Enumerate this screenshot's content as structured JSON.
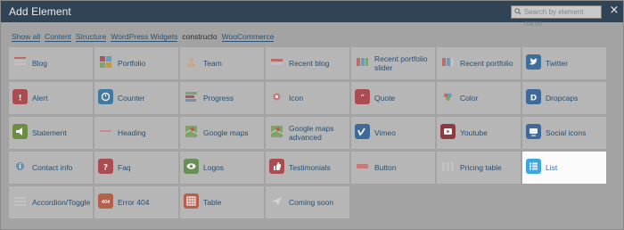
{
  "header": {
    "title": "Add Element",
    "search_placeholder": "Search by element name",
    "close_label": "×"
  },
  "filters": [
    {
      "label": "Show all",
      "kind": "link"
    },
    {
      "label": "Content",
      "kind": "link"
    },
    {
      "label": "Structure",
      "kind": "link"
    },
    {
      "label": "WordPress Widgets",
      "kind": "link"
    },
    {
      "label": "constructo",
      "kind": "plain"
    },
    {
      "label": "WooCommerce",
      "kind": "link"
    }
  ],
  "colors": {
    "header_bg": "#314456",
    "overlay_bg": "#a3a3a3",
    "cell_bg": "#b6b6b6",
    "highlight_bg": "#fbfbfb",
    "link": "#264f73"
  },
  "elements": [
    {
      "label": "Blog",
      "icon": "blog-icon",
      "color": "#9aa3ab"
    },
    {
      "label": "Portfolio",
      "icon": "portfolio-icon",
      "color": "#a3596a"
    },
    {
      "label": "Team",
      "icon": "team-icon",
      "color": "#a88d7a"
    },
    {
      "label": "Recent blog",
      "icon": "recent-blog-icon",
      "color": "#a95860"
    },
    {
      "label": "Recent portfolio slider",
      "icon": "portfolio-slider-icon",
      "color": "#a3596a"
    },
    {
      "label": "Recent portfolio",
      "icon": "recent-portfolio-icon",
      "color": "#a3596a"
    },
    {
      "label": "Twitter",
      "icon": "twitter-icon",
      "color": "#3d6f9a"
    },
    {
      "label": "Alert",
      "icon": "alert-icon",
      "color": "#ab4c52"
    },
    {
      "label": "Counter",
      "icon": "counter-icon",
      "color": "#3f7aa0"
    },
    {
      "label": "Progress",
      "icon": "progress-icon",
      "color": "#6a8f56"
    },
    {
      "label": "Icon",
      "icon": "icon-icon",
      "color": "#ab4c52"
    },
    {
      "label": "Quote",
      "icon": "quote-icon",
      "color": "#ab4c52"
    },
    {
      "label": "Color",
      "icon": "color-icon",
      "color": "#7d8a9a"
    },
    {
      "label": "Dropcaps",
      "icon": "dropcaps-icon",
      "color": "#3d6a9a"
    },
    {
      "label": "Statement",
      "icon": "statement-icon",
      "color": "#6a8f3f"
    },
    {
      "label": "Heading",
      "icon": "heading-icon",
      "color": "#a3a3a3"
    },
    {
      "label": "Google maps",
      "icon": "google-maps-icon",
      "color": "#6a8f56"
    },
    {
      "label": "Google maps advanced",
      "icon": "google-maps-advanced-icon",
      "color": "#6a8f56"
    },
    {
      "label": "Vimeo",
      "icon": "vimeo-icon",
      "color": "#3d6a9a"
    },
    {
      "label": "Youtube",
      "icon": "youtube-icon",
      "color": "#8f3a3f"
    },
    {
      "label": "Social icons",
      "icon": "social-icons-icon",
      "color": "#3d6a9a"
    },
    {
      "label": "Contact info",
      "icon": "contact-info-icon",
      "color": "#c49a3a"
    },
    {
      "label": "Faq",
      "icon": "faq-icon",
      "color": "#ab4c52"
    },
    {
      "label": "Logos",
      "icon": "logos-icon",
      "color": "#6a8f56"
    },
    {
      "label": "Testimonials",
      "icon": "testimonials-icon",
      "color": "#ab4c52"
    },
    {
      "label": "Button",
      "icon": "button-icon",
      "color": "#a95860"
    },
    {
      "label": "Pricing table",
      "icon": "pricing-table-icon",
      "color": "#a3a3a3"
    },
    {
      "label": "List",
      "icon": "list-icon",
      "color": "#3ba6e0",
      "highlighted": true
    },
    {
      "label": "Accordion/Toggle",
      "icon": "accordion-toggle-icon",
      "color": "#a3a3a3"
    },
    {
      "label": "Error 404",
      "icon": "error-404-icon",
      "color": "#b5604a",
      "glyph": "404"
    },
    {
      "label": "Table",
      "icon": "table-icon",
      "color": "#b5604a"
    },
    {
      "label": "Coming soon",
      "icon": "coming-soon-icon",
      "color": "#a3a3a3"
    }
  ]
}
